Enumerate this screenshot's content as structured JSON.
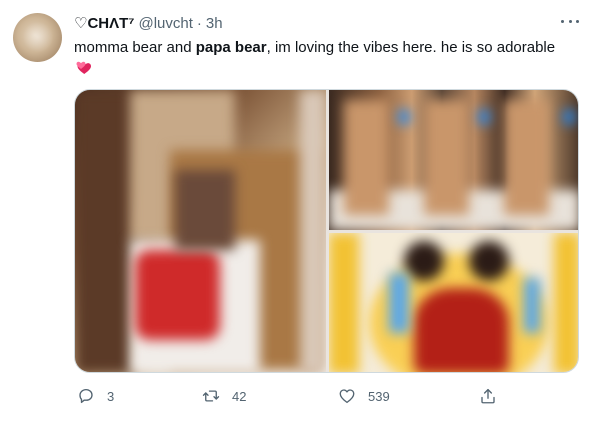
{
  "author": {
    "display_name": "♡CHΛT⁷",
    "handle": "@luvcht",
    "separator": "·",
    "time": "3h"
  },
  "tweet": {
    "text_before": "momma bear and ",
    "text_bold": "papa bear",
    "text_after": ", im loving the vibes here. he is so adorable",
    "emoji": "revolving-hearts-emoji"
  },
  "media": {
    "images": [
      {
        "position": "left",
        "description": "blurred-photo"
      },
      {
        "position": "top-right",
        "description": "blurred-photo"
      },
      {
        "position": "bottom-right",
        "description": "blurred-crying-emoji"
      }
    ]
  },
  "actions": {
    "reply_count": "3",
    "retweet_count": "42",
    "like_count": "539"
  },
  "colors": {
    "text_primary": "#0f1419",
    "text_secondary": "#536471",
    "border": "#cfd9de",
    "emoji_pink": "#e0245e"
  }
}
